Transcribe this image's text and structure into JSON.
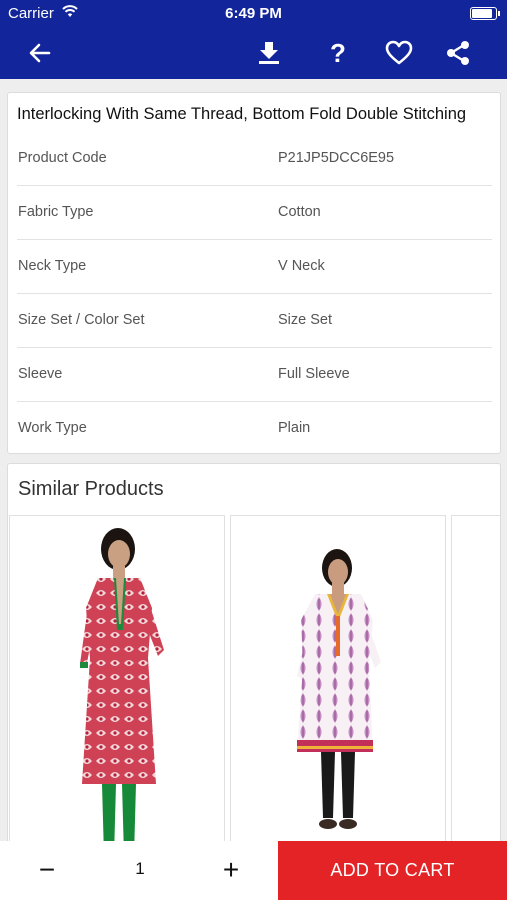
{
  "status_bar": {
    "carrier": "Carrier",
    "time": "6:49 PM"
  },
  "nav": {
    "icons": [
      "back-arrow-icon",
      "download-icon",
      "help-icon",
      "heart-icon",
      "share-icon"
    ],
    "help_glyph": "?"
  },
  "details": {
    "title": "Interlocking With Same Thread, Bottom Fold Double Stitching",
    "rows": [
      {
        "label": "Product Code",
        "value": "P21JP5DCC6E95"
      },
      {
        "label": "Fabric Type",
        "value": "Cotton"
      },
      {
        "label": "Neck Type",
        "value": "V Neck"
      },
      {
        "label": "Size Set / Color Set",
        "value": "Size Set"
      },
      {
        "label": "Sleeve",
        "value": "Full Sleeve"
      },
      {
        "label": "Work Type",
        "value": "Plain"
      }
    ]
  },
  "similar": {
    "title": "Similar Products"
  },
  "cart": {
    "minus": "−",
    "quantity": "1",
    "plus": "+",
    "add_to_cart": "ADD TO CART"
  },
  "colors": {
    "header": "#12259a",
    "cart_button": "#e42327"
  }
}
